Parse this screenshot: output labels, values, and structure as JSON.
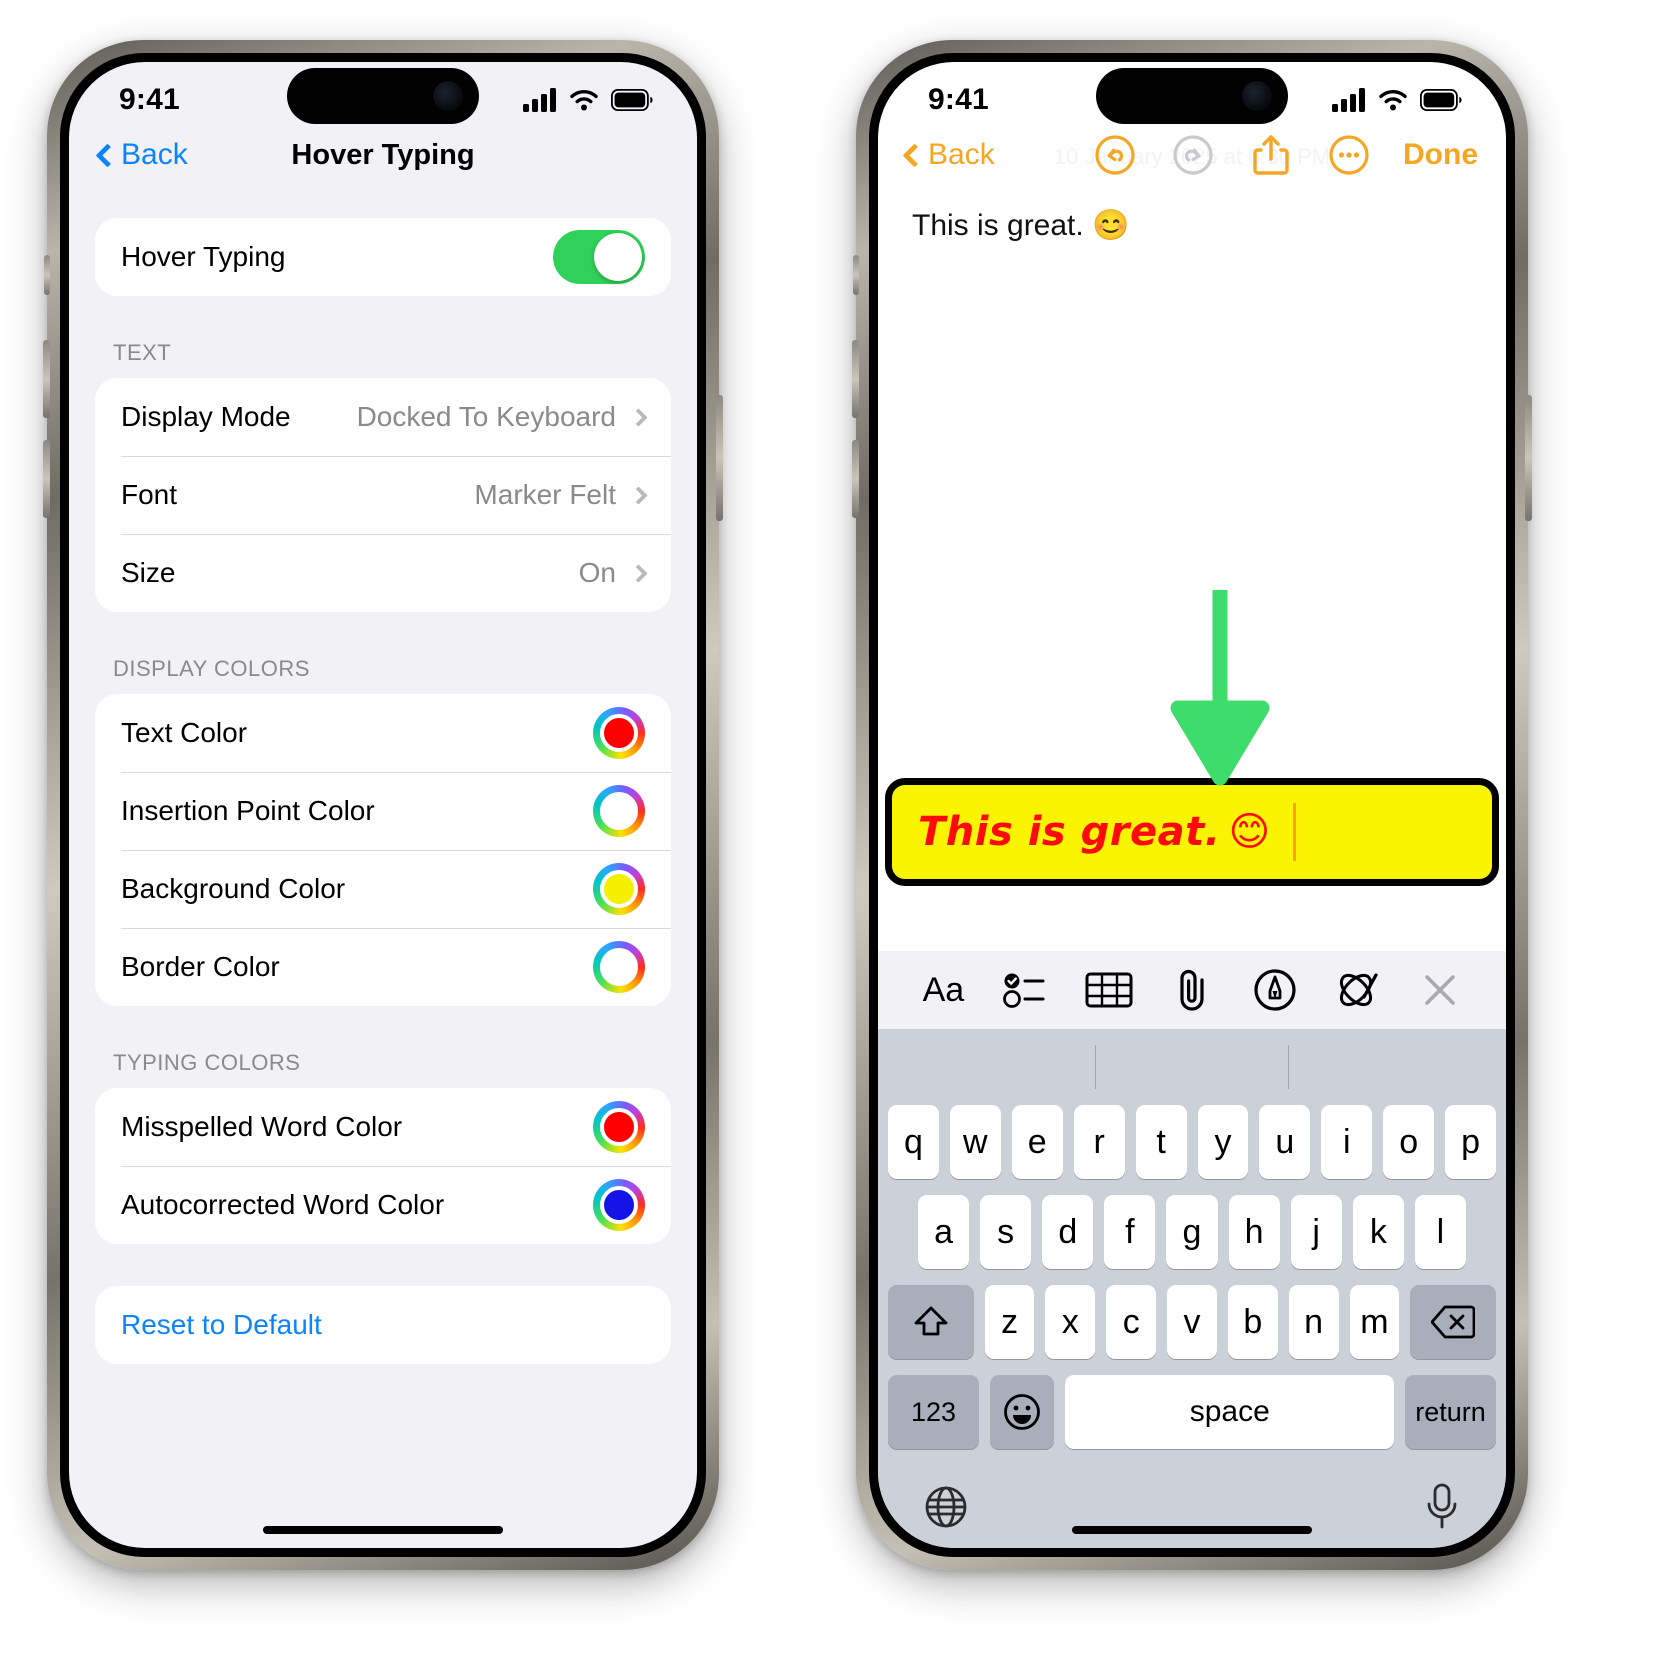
{
  "status_bar": {
    "time": "9:41",
    "cellular_icon": "cellular-signal-icon",
    "wifi_icon": "wifi-icon",
    "battery_icon": "battery-icon"
  },
  "left_phone": {
    "nav": {
      "back_label": "Back",
      "title": "Hover Typing",
      "back_icon": "chevron-left-icon",
      "tint": "#0a84ff"
    },
    "master_toggle": {
      "label": "Hover Typing",
      "state": "on",
      "on_color": "#30d158"
    },
    "sections": [
      {
        "header": "TEXT",
        "rows": [
          {
            "label": "Display Mode",
            "value": "Docked To Keyboard",
            "accessory": "chevron-right-icon"
          },
          {
            "label": "Font",
            "value": "Marker Felt",
            "accessory": "chevron-right-icon"
          },
          {
            "label": "Size",
            "value": "On",
            "accessory": "chevron-right-icon"
          }
        ]
      },
      {
        "header": "DISPLAY COLORS",
        "rows": [
          {
            "label": "Text Color",
            "accessory": "color-well-icon",
            "swatch": "#ff0000"
          },
          {
            "label": "Insertion Point Color",
            "accessory": "color-well-icon",
            "swatch": "#ffffff"
          },
          {
            "label": "Background Color",
            "accessory": "color-well-icon",
            "swatch": "#f5f000"
          },
          {
            "label": "Border Color",
            "accessory": "color-well-icon",
            "swatch": "#ffffff"
          }
        ]
      },
      {
        "header": "TYPING COLORS",
        "rows": [
          {
            "label": "Misspelled Word Color",
            "accessory": "color-well-icon",
            "swatch": "#ff0000"
          },
          {
            "label": "Autocorrected Word Color",
            "accessory": "color-well-icon",
            "swatch": "#1414e6"
          }
        ]
      }
    ],
    "reset": {
      "label": "Reset to Default",
      "color": "#0a84ff"
    }
  },
  "right_phone": {
    "nav": {
      "back_label": "Back",
      "back_icon": "chevron-left-icon",
      "undo_icon": "undo-icon",
      "redo_icon": "redo-icon",
      "share_icon": "share-icon",
      "more_icon": "more-ellipsis-icon",
      "done_label": "Done",
      "tint": "#f5a623",
      "redo_disabled": true
    },
    "note": {
      "date": "10 January 2025 at 6:30 PM",
      "text": "This is great. 😊"
    },
    "annotation": {
      "arrow_icon": "down-arrow-annotation",
      "color": "#3ddc6b"
    },
    "hover_bar": {
      "text": "This is great.",
      "emoji": "😊",
      "background": "#fbf400",
      "border": "#000000",
      "text_color": "#ff0a0a",
      "caret_color": "#ff9f0a"
    },
    "keyboard": {
      "toolbar": [
        {
          "name": "format-aa-icon",
          "label": "Aa"
        },
        {
          "name": "checklist-icon",
          "label": ""
        },
        {
          "name": "table-icon",
          "label": ""
        },
        {
          "name": "paperclip-icon",
          "label": ""
        },
        {
          "name": "markup-pen-icon",
          "label": ""
        },
        {
          "name": "scribble-icon",
          "label": ""
        },
        {
          "name": "close-icon",
          "label": ""
        }
      ],
      "row1": [
        "q",
        "w",
        "e",
        "r",
        "t",
        "y",
        "u",
        "i",
        "o",
        "p"
      ],
      "row2": [
        "a",
        "s",
        "d",
        "f",
        "g",
        "h",
        "j",
        "k",
        "l"
      ],
      "row3": [
        "z",
        "x",
        "c",
        "v",
        "b",
        "n",
        "m"
      ],
      "shift_icon": "shift-icon",
      "backspace_icon": "backspace-icon",
      "numbers_label": "123",
      "emoji_icon": "emoji-smiley-icon",
      "space_label": "space",
      "return_label": "return",
      "globe_icon": "globe-icon",
      "mic_icon": "microphone-icon"
    }
  }
}
